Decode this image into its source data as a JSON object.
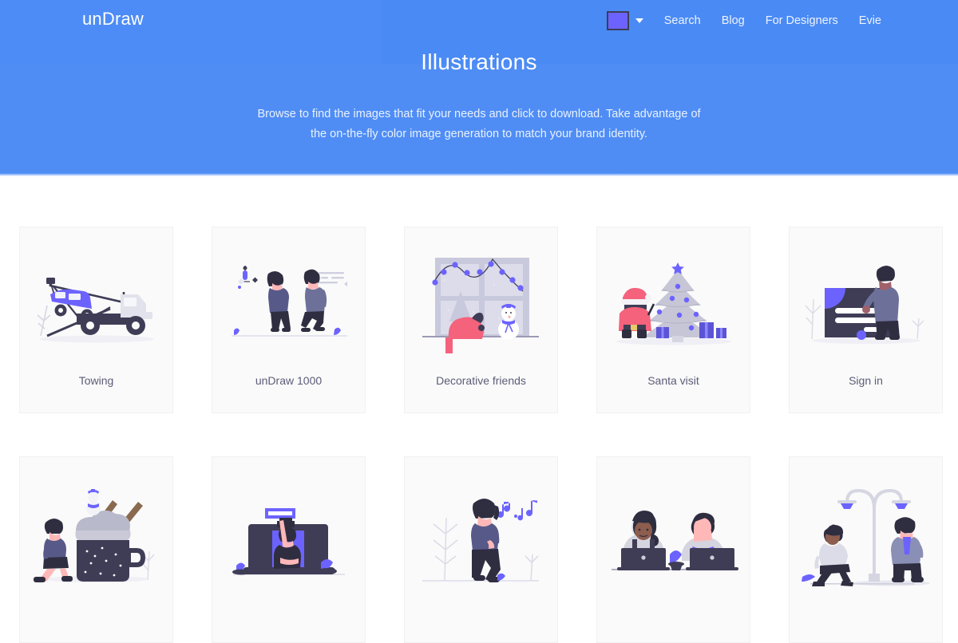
{
  "site": {
    "brand": "unDraw"
  },
  "nav": {
    "color_swatch": {
      "name": "color-picker-swatch",
      "value": "#6c63ff",
      "caret": "chevron-down-icon"
    },
    "links": [
      {
        "label": "Search"
      },
      {
        "label": "Blog"
      },
      {
        "label": "For Designers"
      },
      {
        "label": "Evie"
      }
    ]
  },
  "hero": {
    "title": "Illustrations",
    "subtitle_line1": "Browse to find the images that fit your needs and click to download. Take advantage of",
    "subtitle_line2": "the on-the-fly color image generation to match your brand identity.",
    "background_color": "#4c8bf5"
  },
  "gallery": {
    "cards": [
      {
        "label": "Towing",
        "art": "towing"
      },
      {
        "label": "unDraw 1000",
        "art": "undraw-1000"
      },
      {
        "label": "Decorative friends",
        "art": "decorative-friends"
      },
      {
        "label": "Santa visit",
        "art": "santa-visit"
      },
      {
        "label": "Sign in",
        "art": "sign-in"
      },
      {
        "label": "",
        "art": "hot-chocolate"
      },
      {
        "label": "",
        "art": "graduation-laptop"
      },
      {
        "label": "",
        "art": "listening-music"
      },
      {
        "label": "",
        "art": "coworking-laptops"
      },
      {
        "label": "",
        "art": "street-lamp-walk"
      }
    ]
  },
  "theme": {
    "accent_purple": "#6c63ff",
    "dark_navy": "#3f3d56",
    "card_bg": "#fafafa",
    "label_color": "#5c5c78",
    "pink": "#ff6884",
    "skin": "#ffb8b8"
  }
}
